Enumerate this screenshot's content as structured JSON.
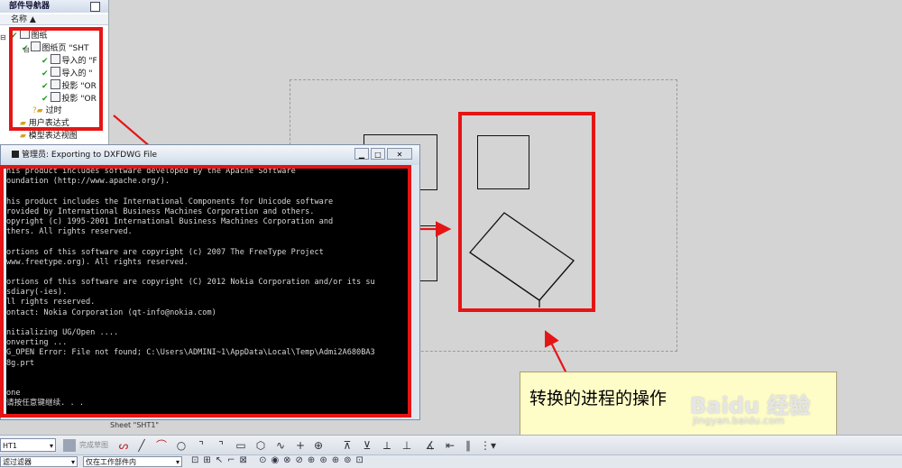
{
  "part_navigator": {
    "title": "部件导航器",
    "column_header": "名称",
    "items": [
      {
        "label": "图纸",
        "indent": 1
      },
      {
        "label": "图纸页 \"SHT",
        "indent": 2
      },
      {
        "label": "导入的 \"F",
        "indent": 3
      },
      {
        "label": "导入的 \"",
        "indent": 3
      },
      {
        "label": "投影 \"OR",
        "indent": 3
      },
      {
        "label": "投影 \"OR",
        "indent": 3
      }
    ],
    "extra_items": [
      "过时",
      "用户表达式",
      "模型表达视图"
    ]
  },
  "console_window": {
    "title": "管理员: Exporting to DXFDWG File",
    "lines": [
      "his product includes software developed by the Apache Software",
      "oundation (http://www.apache.org/).",
      "",
      "his product includes the International Components for Unicode software",
      "rovided by International Business Machines Corporation and others.",
      "opyright (c) 1995-2001 International Business Machines Corporation and",
      "thers. All rights reserved.",
      "",
      "ortions of this software are copyright (c) 2007 The FreeType Project",
      "www.freetype.org). All rights reserved.",
      "",
      "ortions of this software are copyright (C) 2012 Nokia Corporation and/or its su",
      "sdiary(-ies).",
      "ll rights reserved.",
      "ontact: Nokia Corporation (qt-info@nokia.com)",
      "",
      "nitializing UG/Open ....",
      "onverting ...",
      "G_OPEN Error: File not found; C:\\Users\\ADMINI~1\\AppData\\Local\\Temp\\Admi2A680BA3",
      "8g.prt",
      "",
      "",
      "one",
      "请按任意键继续. . ."
    ]
  },
  "annotation": {
    "text": "转换的进程的操作"
  },
  "sheet_label": "Sheet \"SHT1\"",
  "toolbar": {
    "sheet_select": "HT1",
    "finish_sketch_label": "完成草图",
    "filter_select": "滤过滤器",
    "scope_select": "仅在工作部件内"
  },
  "watermark": {
    "brand": "Baidu 经验",
    "url": "jingyan.baidu.com"
  },
  "colors": {
    "highlight_red": "#e51515",
    "note_background": "#fefdc8",
    "console_background": "#000000",
    "canvas_background": "#d4d4d4"
  }
}
